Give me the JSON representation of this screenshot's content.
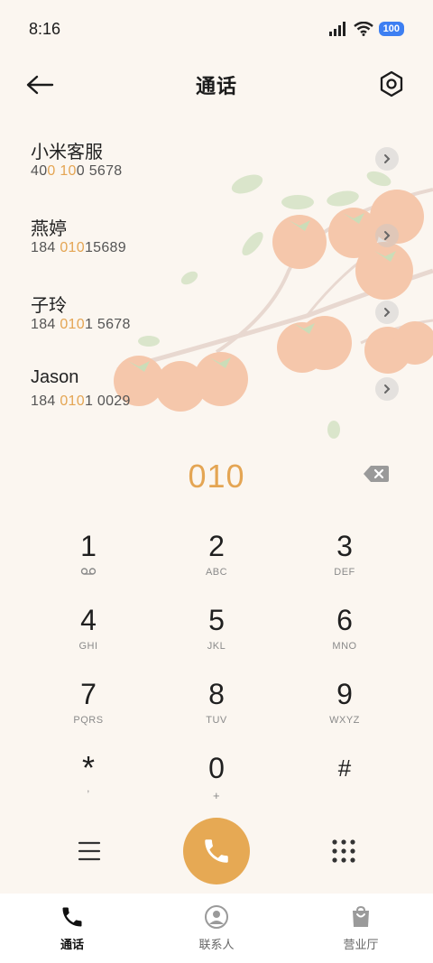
{
  "status_bar": {
    "time": "8:16",
    "battery": "100"
  },
  "header": {
    "title": "通话"
  },
  "contacts": [
    {
      "name": "小米客服",
      "number_parts": [
        "40",
        "0",
        " ",
        "10",
        "0 5678"
      ]
    },
    {
      "name": "燕婷",
      "number_parts": [
        "184 ",
        "010",
        "15689"
      ]
    },
    {
      "name": "子玲",
      "number_parts": [
        "184 ",
        "010",
        "1 5678"
      ]
    },
    {
      "name": "Jason",
      "number_parts": [
        "184 ",
        "010",
        "1 0029"
      ]
    }
  ],
  "dialed_number": "010",
  "keypad": [
    {
      "digit": "1",
      "letters": ""
    },
    {
      "digit": "2",
      "letters": "ABC"
    },
    {
      "digit": "3",
      "letters": "DEF"
    },
    {
      "digit": "4",
      "letters": "GHI"
    },
    {
      "digit": "5",
      "letters": "JKL"
    },
    {
      "digit": "6",
      "letters": "MNO"
    },
    {
      "digit": "7",
      "letters": "PQRS"
    },
    {
      "digit": "8",
      "letters": "TUV"
    },
    {
      "digit": "9",
      "letters": "WXYZ"
    },
    {
      "digit": "*",
      "letters": ","
    },
    {
      "digit": "0",
      "letters": "+"
    },
    {
      "digit": "#",
      "letters": ""
    }
  ],
  "tabs": [
    {
      "label": "通话",
      "icon": "phone-icon",
      "active": true
    },
    {
      "label": "联系人",
      "icon": "person-icon",
      "active": false
    },
    {
      "label": "营业厅",
      "icon": "shopping-bag-icon",
      "active": false
    }
  ],
  "colors": {
    "accent": "#e6a954",
    "highlight": "#e4a553",
    "background": "#fbf6f0"
  }
}
